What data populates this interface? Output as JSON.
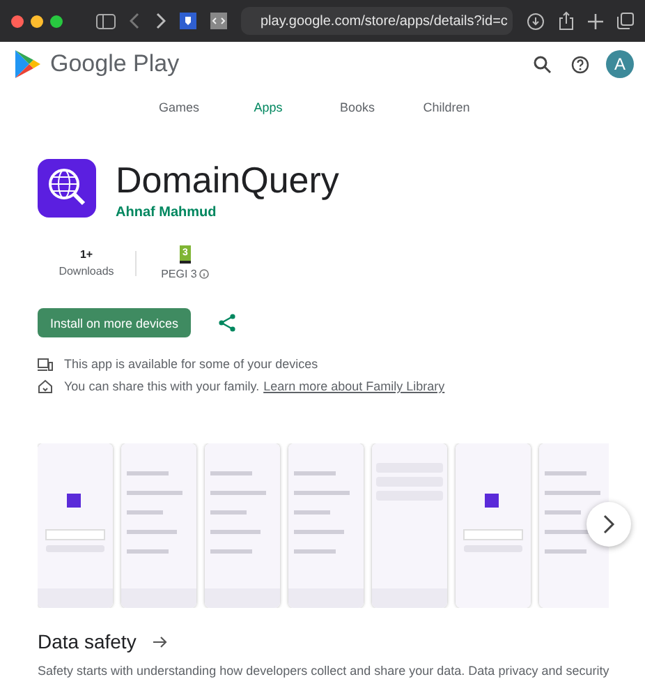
{
  "browser": {
    "url": "play.google.com/store/apps/details?id=c"
  },
  "header": {
    "brand": "Google Play",
    "avatar": "A"
  },
  "nav": [
    {
      "label": "Games",
      "selected": false
    },
    {
      "label": "Apps",
      "selected": true
    },
    {
      "label": "Books",
      "selected": false
    },
    {
      "label": "Children",
      "selected": false
    }
  ],
  "app": {
    "title": "DomainQuery",
    "developer": "Ahnaf Mahmud"
  },
  "stats": [
    {
      "kind": "text",
      "value": "1+",
      "label": "Downloads"
    },
    {
      "kind": "rating",
      "value": "3",
      "label": "PEGI 3"
    }
  ],
  "install_button": "Install on more devices",
  "notices": [
    {
      "kind": "devices",
      "text": "This app is available for some of your devices"
    },
    {
      "kind": "family",
      "text": "You can share this with your family.",
      "link": "Learn more about Family Library"
    }
  ],
  "data_safety": {
    "title": "Data safety",
    "body": "Safety starts with understanding how developers collect and share your data. Data privacy and security"
  }
}
